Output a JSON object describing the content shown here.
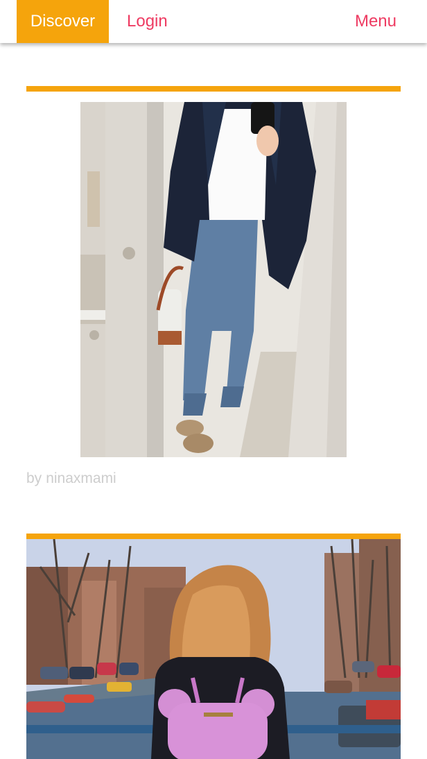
{
  "nav": {
    "discover_label": "Discover",
    "login_label": "Login",
    "menu_label": "Menu"
  },
  "colors": {
    "accent": "#f5a40c",
    "link": "#ee3b62",
    "byline": "#cdcdcd"
  },
  "feed": {
    "posts": [
      {
        "image": "mirror-selfie-photo",
        "by_label": "by",
        "author": "ninaxmami"
      },
      {
        "image": "canal-backpack-photo"
      }
    ]
  }
}
